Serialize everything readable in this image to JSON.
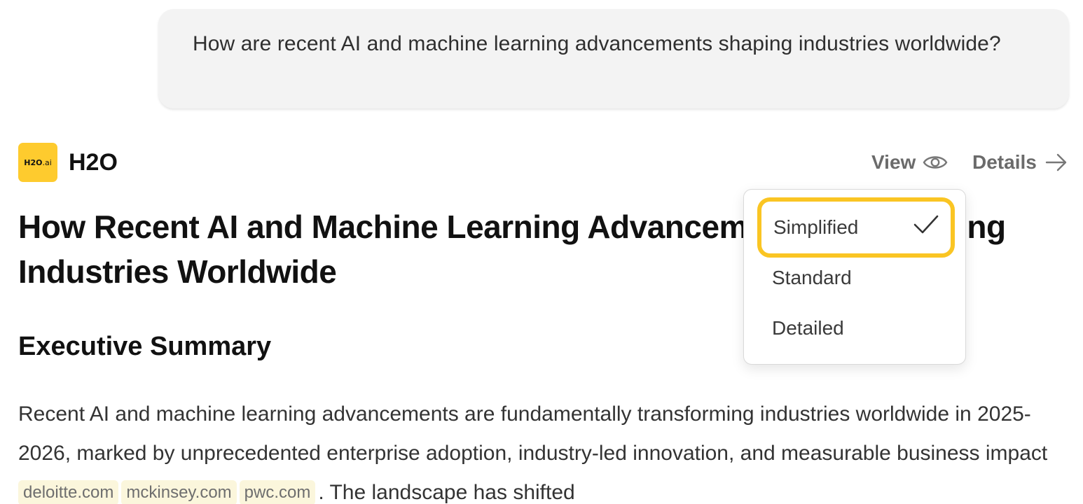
{
  "prompt": {
    "text": "How are recent AI and machine learning advancements shaping industries worldwide?"
  },
  "assistant": {
    "logo_text_bold": "H2O",
    "logo_text_suffix": ".ai",
    "name": "H2O",
    "view_label": "View",
    "details_label": "Details",
    "icons": [
      "eye-icon",
      "arrow-right-icon",
      "checkmark-icon"
    ]
  },
  "view_menu": {
    "options": [
      {
        "label": "Simplified",
        "selected": true
      },
      {
        "label": "Standard",
        "selected": false
      },
      {
        "label": "Detailed",
        "selected": false
      }
    ],
    "highlight_color": "#fac523"
  },
  "article": {
    "title": "How Recent AI and Machine Learning Advancements Are Shaping Industries Worldwide",
    "section_heading": "Executive Summary",
    "paragraph_part1": "Recent AI and machine learning advancements are fundamentally transforming industries worldwide in 2025-2026, marked by unprecedented enterprise adoption, industry-led innovation, and measurable business impact",
    "sources": [
      "deloitte.com",
      "mckinsey.com",
      "pwc.com"
    ],
    "paragraph_part2": ". The landscape has shifted"
  },
  "colors": {
    "logo_bg": "#fecb2e",
    "source_chip_bg": "#fbf6dc",
    "prompt_bubble_bg": "#f3f3f3"
  }
}
